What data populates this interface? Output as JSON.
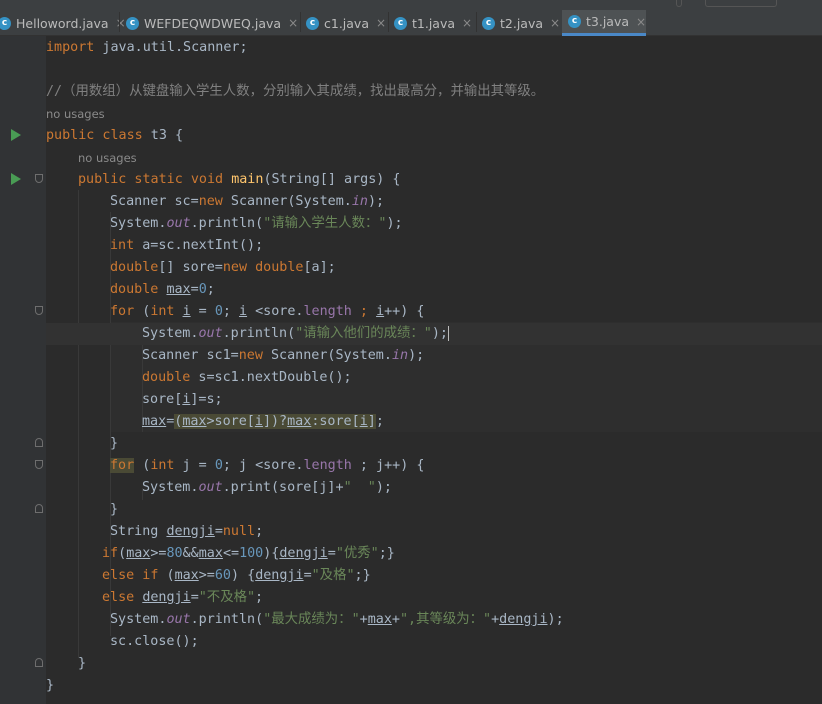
{
  "tabs": [
    {
      "label": "Helloword.java",
      "active": false
    },
    {
      "label": "WEFDEQWDWEQ.java",
      "active": false
    },
    {
      "label": "c1.java",
      "active": false
    },
    {
      "label": "t1.java",
      "active": false
    },
    {
      "label": "t2.java",
      "active": false
    },
    {
      "label": "t3.java",
      "active": true
    }
  ],
  "close_glyph": "×",
  "hints": {
    "class_usages": "no usages",
    "method_usages": "no usages"
  },
  "code": {
    "import_kw": "import",
    "import_rest": " java.util.Scanner;",
    "comment": "//（用数组）从键盘输入学生人数，分别输入其成绩，找出最高分，并输出其等级。",
    "class_decl_kw": "public class",
    "class_decl_rest": " t3 {",
    "main_kw": "public static void",
    "main_name": "main",
    "main_rest": "(String[] args) {",
    "l_scanner_a": "Scanner sc=",
    "l_scanner_new": "new",
    "l_scanner_b": " Scanner(System.",
    "l_scanner_in": "in",
    "l_scanner_c": ");",
    "l_print1_a": "System.",
    "l_print1_out": "out",
    "l_print1_b": ".println(",
    "l_print1_str": "\"请输入学生人数：\"",
    "l_print1_c": ");",
    "l_int_kw": "int",
    "l_int_rest": " a=sc.nextInt();",
    "l_arr_kw": "double",
    "l_arr_a": "[] sore=",
    "l_arr_new": "new",
    "l_arr_kw2": " double",
    "l_arr_b": "[a];",
    "l_max_kw": "double",
    "l_max_sp": " ",
    "l_max_var": "max",
    "l_max_eq": "=",
    "l_max_num": "0",
    "l_max_end": ";",
    "l_for1_kw": "for",
    "l_for1_a": " (",
    "l_for1_int": "int",
    "l_for1_sp": " ",
    "l_for1_i": "i",
    "l_for1_b": " = ",
    "l_for1_0": "0",
    "l_for1_c": "; ",
    "l_for1_i2": "i",
    "l_for1_d": " <sore.",
    "l_for1_len": "length",
    "l_for1_e": " ; ",
    "l_for1_i3": "i",
    "l_for1_f": "++) {",
    "l_print2_a": "System.",
    "l_print2_out": "out",
    "l_print2_b": ".println(",
    "l_print2_str": "\"请输入他们的成绩：\"",
    "l_print2_c": ");",
    "l_sc1_a": "Scanner sc1=",
    "l_sc1_new": "new",
    "l_sc1_b": " Scanner(System.",
    "l_sc1_in": "in",
    "l_sc1_c": ");",
    "l_s_kw": "double",
    "l_s_rest": " s=sc1.nextDouble();",
    "l_sore_a": "sore[",
    "l_sore_i": "i",
    "l_sore_b": "]=s;",
    "l_maxcalc_var": "max",
    "l_maxcalc_eq": "=",
    "l_maxcalc_a": "(",
    "l_maxcalc_max1": "max",
    "l_maxcalc_b": ">sore[",
    "l_maxcalc_i1": "i",
    "l_maxcalc_c": "])?",
    "l_maxcalc_max2": "max",
    "l_maxcalc_d": ":sore[",
    "l_maxcalc_i2": "i",
    "l_maxcalc_e": "]",
    "l_maxcalc_end": ";",
    "l_brace1": "}",
    "l_for2_kw": "for",
    "l_for2_a": " (",
    "l_for2_int": "int",
    "l_for2_b": " j = ",
    "l_for2_0": "0",
    "l_for2_c": "; j <sore.",
    "l_for2_len": "length",
    "l_for2_d": " ; j++) {",
    "l_print3_a": "System.",
    "l_print3_out": "out",
    "l_print3_b": ".print(sore[j]+",
    "l_print3_str": "\"  \"",
    "l_print3_c": ");",
    "l_brace2": "}",
    "l_dj_a": "String ",
    "l_dj_var": "dengji",
    "l_dj_eq": "=",
    "l_dj_null": "null",
    "l_dj_end": ";",
    "l_if_kw": "if",
    "l_if_a": "(",
    "l_if_max1": "max",
    "l_if_b": ">=",
    "l_if_80": "80",
    "l_if_c": "&&",
    "l_if_max2": "max",
    "l_if_d": "<=",
    "l_if_100": "100",
    "l_if_e": "){",
    "l_if_dj": "dengji",
    "l_if_f": "=",
    "l_if_str": "\"优秀\"",
    "l_if_g": ";}",
    "l_elif_kw": "else if",
    "l_elif_a": " (",
    "l_elif_max": "max",
    "l_elif_b": ">=",
    "l_elif_60": "60",
    "l_elif_c": ") {",
    "l_elif_dj": "dengji",
    "l_elif_d": "=",
    "l_elif_str": "\"及格\"",
    "l_elif_e": ";}",
    "l_else_kw": "else",
    "l_else_sp": " ",
    "l_else_dj": "dengji",
    "l_else_a": "=",
    "l_else_str": "\"不及格\"",
    "l_else_b": ";",
    "l_print4_a": "System.",
    "l_print4_out": "out",
    "l_print4_b": ".println(",
    "l_print4_str1": "\"最大成绩为：\"",
    "l_print4_c": "+",
    "l_print4_max": "max",
    "l_print4_d": "+",
    "l_print4_str2": "\",其等级为：\"",
    "l_print4_e": "+",
    "l_print4_dj": "dengji",
    "l_print4_f": ");",
    "l_close": "sc.close();",
    "l_brace3": "}",
    "l_brace4": "}"
  },
  "colors": {
    "keyword": "#cc7832",
    "string": "#6a8759",
    "number": "#6897bb",
    "field": "#9876aa",
    "comment": "#808080",
    "method": "#ffc66d",
    "text": "#a9b7c6",
    "background": "#2b2b2b",
    "active_tab_underline": "#4a88c7",
    "run_icon": "#499c54"
  }
}
